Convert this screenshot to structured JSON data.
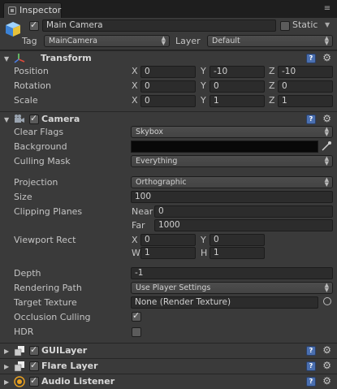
{
  "tab": {
    "label": "Inspector"
  },
  "gameobject": {
    "name": "Main Camera",
    "static_label": "Static",
    "tag_label": "Tag",
    "tag_value": "MainCamera",
    "layer_label": "Layer",
    "layer_value": "Default"
  },
  "transform": {
    "title": "Transform",
    "rows": [
      {
        "label": "Position",
        "x": "0",
        "y": "-10",
        "z": "-10"
      },
      {
        "label": "Rotation",
        "x": "0",
        "y": "0",
        "z": "0"
      },
      {
        "label": "Scale",
        "x": "0",
        "y": "1",
        "z": "1"
      }
    ],
    "axes": {
      "x": "X",
      "y": "Y",
      "z": "Z"
    }
  },
  "camera": {
    "title": "Camera",
    "clear_flags_label": "Clear Flags",
    "clear_flags_value": "Skybox",
    "background_label": "Background",
    "background_color": "#080808",
    "culling_mask_label": "Culling Mask",
    "culling_mask_value": "Everything",
    "projection_label": "Projection",
    "projection_value": "Orthographic",
    "size_label": "Size",
    "size_value": "100",
    "clipping_label": "Clipping Planes",
    "near_label": "Near",
    "near_value": "0",
    "far_label": "Far",
    "far_value": "1000",
    "viewport_label": "Viewport Rect",
    "vp_x_label": "X",
    "vp_x": "0",
    "vp_y_label": "Y",
    "vp_y": "0",
    "vp_w_label": "W",
    "vp_w": "1",
    "vp_h_label": "H",
    "vp_h": "1",
    "depth_label": "Depth",
    "depth_value": "-1",
    "rendering_label": "Rendering Path",
    "rendering_value": "Use Player Settings",
    "target_label": "Target Texture",
    "target_value": "None (Render Texture)",
    "occlusion_label": "Occlusion Culling",
    "occlusion_checked": true,
    "hdr_label": "HDR",
    "hdr_checked": false
  },
  "components": [
    {
      "title": "GUILayer"
    },
    {
      "title": "Flare Layer"
    },
    {
      "title": "Audio Listener"
    }
  ],
  "icons": {
    "help": "?",
    "gear": "⚙"
  }
}
